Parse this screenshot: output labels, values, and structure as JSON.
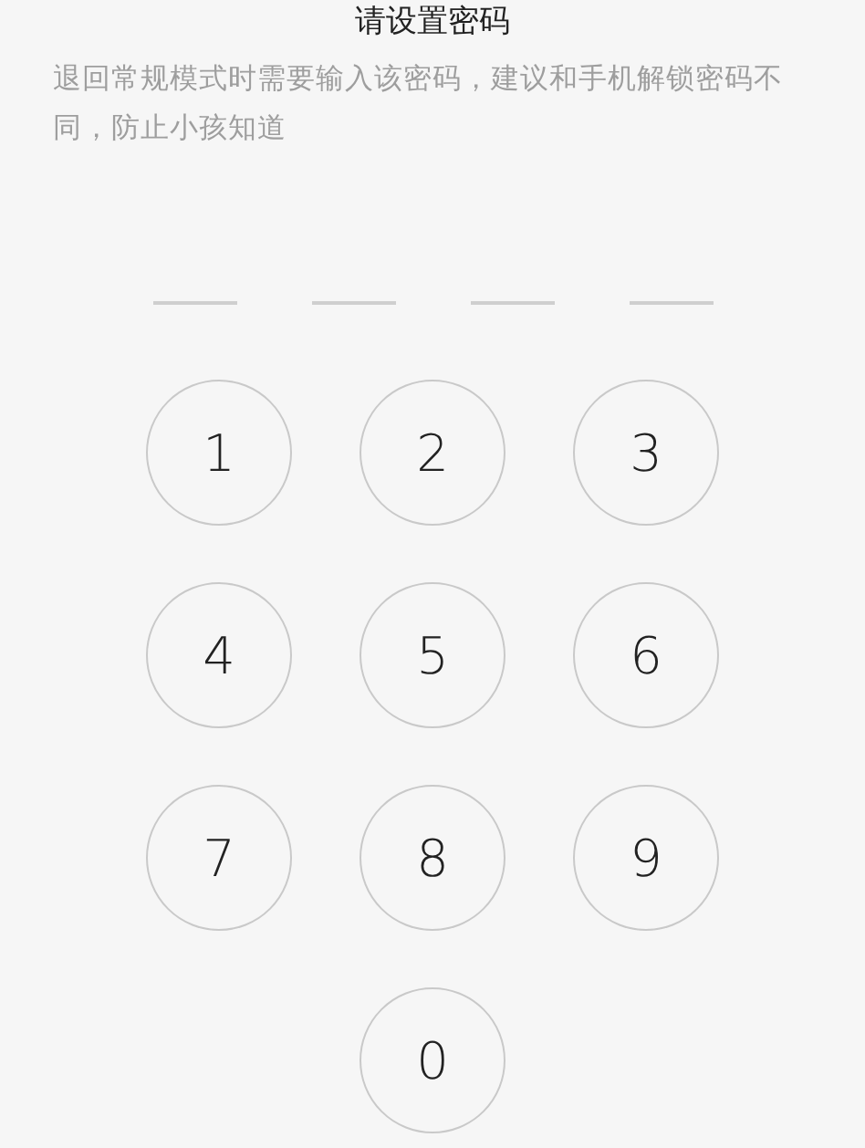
{
  "title": "请设置密码",
  "description": "退回常规模式时需要输入该密码，建议和手机解锁密码不同，防止小孩知道",
  "slots": [
    {
      "filled": false
    },
    {
      "filled": false
    },
    {
      "filled": false
    },
    {
      "filled": false
    }
  ],
  "keys": [
    "1",
    "2",
    "3",
    "4",
    "5",
    "6",
    "7",
    "8",
    "9",
    "0"
  ]
}
